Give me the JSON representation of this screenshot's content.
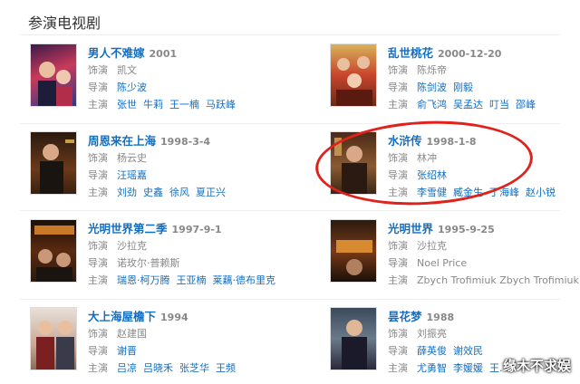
{
  "section": {
    "title": "参演电视剧"
  },
  "labels": {
    "role": "饰演",
    "director": "导演",
    "cast": "主演"
  },
  "colors": {
    "link": "#136ec2",
    "highlight_circle": "#e0211c"
  },
  "shows": [
    {
      "title": "男人不难嫁",
      "date": "2001",
      "role": "凯文",
      "director": [
        "陈少波"
      ],
      "cast": [
        "张世",
        "牛莉",
        "王一楠",
        "马跃峰"
      ]
    },
    {
      "title": "乱世桃花",
      "date": "2000-12-20",
      "role": "陈烁帝",
      "director": [
        "陈剑波",
        "刚毅"
      ],
      "cast": [
        "俞飞鸿",
        "吴孟达",
        "叮当",
        "邵峰"
      ]
    },
    {
      "title": "周恩来在上海",
      "date": "1998-3-4",
      "role": "杨云史",
      "director": [
        "汪瑶嘉"
      ],
      "cast": [
        "刘劲",
        "史鑫",
        "徐风",
        "夏正兴"
      ]
    },
    {
      "title": "水浒传",
      "date": "1998-1-8",
      "role": "林冲",
      "director": [
        "张绍林"
      ],
      "cast": [
        "李雪健",
        "臧金生",
        "丁海峰",
        "赵小锐"
      ]
    },
    {
      "title": "光明世界第二季",
      "date": "1997-9-1",
      "role": "沙拉克",
      "director": [
        "诺玫尔·普赖斯"
      ],
      "cast": [
        "瑞恩·柯万腾",
        "王亚楠",
        "莱藕·德布里克"
      ]
    },
    {
      "title": "光明世界",
      "date": "1995-9-25",
      "role": "沙拉克",
      "director_plain": "Noel Price",
      "cast_plain": "Zbych Trofimiuk Zbych Trofimiuk"
    },
    {
      "title": "大上海屋檐下",
      "date": "1994",
      "role": "赵建国",
      "director": [
        "谢晋"
      ],
      "cast": [
        "吕凉",
        "吕晓禾",
        "张芝华",
        "王频"
      ]
    },
    {
      "title": "昙花梦",
      "date": "1988",
      "role": "刘振亮",
      "director": [
        "薛英俊",
        "谢效民"
      ],
      "cast": [
        "尤勇智",
        "李媛媛",
        "王..."
      ]
    }
  ],
  "watermark": "缘木不求娱"
}
